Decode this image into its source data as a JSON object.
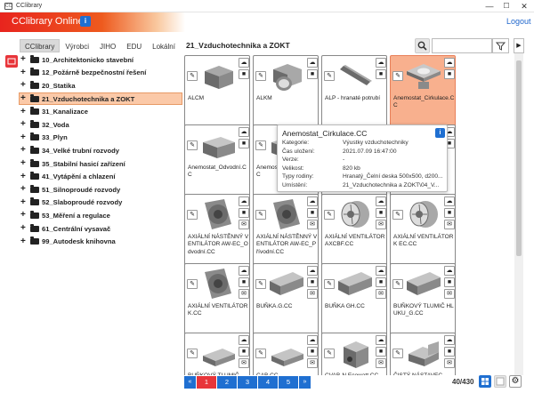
{
  "window": {
    "title": "CClibrary",
    "app_icon": "CC",
    "min": "—",
    "max": "☐",
    "close": "✕"
  },
  "header": {
    "brand": "CClibrary Online",
    "info_label": "i",
    "logout": "Logout"
  },
  "tabs": [
    {
      "label": "CClibrary",
      "active": true
    },
    {
      "label": "Výrobci",
      "active": false
    },
    {
      "label": "JIHO",
      "active": false
    },
    {
      "label": "EDU",
      "active": false
    },
    {
      "label": "Lokální",
      "active": false
    }
  ],
  "breadcrumb": "21_Vzduchotechnika a ZOKT",
  "search": {
    "placeholder": "",
    "value": ""
  },
  "tree": [
    {
      "label": "10_Architektonicko stavební",
      "selected": false
    },
    {
      "label": "12_Požárně bezpečnostní řešení",
      "selected": false
    },
    {
      "label": "20_Statika",
      "selected": false
    },
    {
      "label": "21_Vzduchotechnika a ZOKT",
      "selected": true
    },
    {
      "label": "31_Kanalizace",
      "selected": false
    },
    {
      "label": "32_Voda",
      "selected": false
    },
    {
      "label": "33_Plyn",
      "selected": false
    },
    {
      "label": "34_Velké trubní rozvody",
      "selected": false
    },
    {
      "label": "35_Stabilní hasicí zařízení",
      "selected": false
    },
    {
      "label": "41_Vytápění a chlazení",
      "selected": false
    },
    {
      "label": "51_Silnoproudé rozvody",
      "selected": false
    },
    {
      "label": "52_Slaboproudé rozvody",
      "selected": false
    },
    {
      "label": "53_Měření a regulace",
      "selected": false
    },
    {
      "label": "61_Centrální vysavač",
      "selected": false
    },
    {
      "label": "99_Autodesk knihovna",
      "selected": false
    }
  ],
  "cards": [
    {
      "name": "ALCM",
      "thumb": "box-unit",
      "selected": false
    },
    {
      "name": "ALKM",
      "thumb": "round-box",
      "selected": false
    },
    {
      "name": "ALP - hranaté potrubí",
      "thumb": "duct-bar",
      "selected": false
    },
    {
      "name": "Anemostat_Cirkulace.CC",
      "thumb": "diffuser",
      "selected": true
    },
    {
      "name": "Anemostat_Odvodní.CC",
      "thumb": "square-diffuser",
      "selected": false
    },
    {
      "name": "Anemostat_Přívodní.CC",
      "thumb": "square-diffuser",
      "selected": false
    },
    {
      "name": "",
      "thumb": "none",
      "selected": false
    },
    {
      "name": "",
      "thumb": "none",
      "selected": false
    },
    {
      "name": "AXIÁLNÍ NÁSTĚNNÝ VENTILÁTOR AW-EC_Odvodní.CC",
      "thumb": "wall-fan",
      "selected": false
    },
    {
      "name": "AXIÁLNÍ NÁSTĚNNÝ VENTILÁTOR AW-EC_Přívodní.CC",
      "thumb": "wall-fan",
      "selected": false
    },
    {
      "name": "AXIÁLNÍ VENTILÁTOR AXCBF.CC",
      "thumb": "axial-fan",
      "selected": false
    },
    {
      "name": "AXIÁLNÍ VENTILÁTOR K EC.CC",
      "thumb": "axial-fan",
      "selected": false
    },
    {
      "name": "AXIÁLNÍ VENTILÁTOR K.CC",
      "thumb": "wall-fan",
      "selected": false
    },
    {
      "name": "BUŇKA.G.CC",
      "thumb": "long-box",
      "selected": false
    },
    {
      "name": "BUŇKA GH.CC",
      "thumb": "long-box",
      "selected": false
    },
    {
      "name": "BUŇKOVÝ TLUMIČ HLUKU_G.CC",
      "thumb": "long-box",
      "selected": false
    },
    {
      "name": "BUŇKOVÝ TLUMIČ",
      "thumb": "flat-box",
      "selected": false
    },
    {
      "name": "CAB.CC",
      "thumb": "flat-box",
      "selected": false
    },
    {
      "name": "CVAB-N Ecowatt.CC",
      "thumb": "cube-box",
      "selected": false
    },
    {
      "name": "ČISTÝ NÁSTAVEC",
      "thumb": "bend-box",
      "selected": false
    }
  ],
  "tooltip": {
    "title": "Anemostat_Cirkulace.CC",
    "info": "i",
    "rows": [
      {
        "k": "Kategorie:",
        "v": "Výustky vzduchotechniky"
      },
      {
        "k": "Čas uložení:",
        "v": "2021.07.09 16:47:00"
      },
      {
        "k": "Verze:",
        "v": "-"
      },
      {
        "k": "Velikost:",
        "v": "820 kb"
      },
      {
        "k": "Typy rodiny:",
        "v": "Hranatý_Čelní deska 500x500, d200..."
      },
      {
        "k": "Umístění:",
        "v": "21_Vzduchotechnika a ZOKT\\04_V..."
      }
    ]
  },
  "pager": {
    "prev": "«",
    "next": "»",
    "pages": [
      "1",
      "2",
      "3",
      "4",
      "5"
    ],
    "current": "1",
    "count": "40/430"
  },
  "colors": {
    "accent": "#1f6fd1",
    "brand": "#e8241e",
    "selection": "#fbc9a8"
  }
}
